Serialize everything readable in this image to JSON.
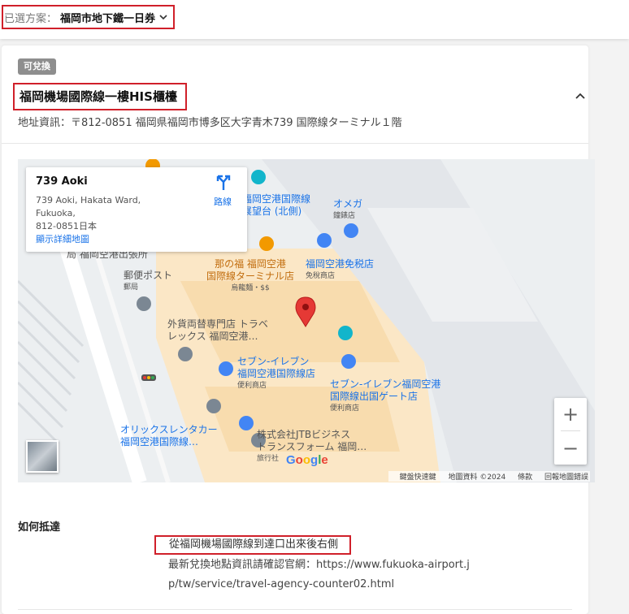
{
  "plan": {
    "prefix": "已選方案：",
    "value": "福岡市地下鐵一日券"
  },
  "location": {
    "badge": "可兌換",
    "title": "福岡機場國際線一樓HIS櫃檯",
    "address": "地址資訊：〒812-0851 福岡県福岡市博多区大字青木739 国際線ターミナル１階"
  },
  "map": {
    "place_card": {
      "title": "739 Aoki",
      "address_line1": "739 Aoki, Hakata Ward, Fukuoka,",
      "address_line2": "812-0851日本",
      "directions_label": "路線",
      "view_larger_label": "顯示詳細地圖"
    },
    "labels": {
      "airport_observation_1": "福岡空港国際線",
      "airport_observation_2": "展望台 (北側)",
      "omega_1": "オメガ",
      "omega_2": "鐘錶店",
      "duty_free_1": "福岡空港免税店",
      "duty_free_2": "免稅商店",
      "nanofuku_1": "那の福 福岡空港",
      "nanofuku_2": "国際線ターミナル店",
      "nanofuku_3": "烏龍麵・$$",
      "post_1": "郵便ポスト",
      "post_2": "郵局",
      "travelex_1": "外貨両替専門店 トラベ",
      "travelex_2": "レックス 福岡空港…",
      "seven1_1": "セブン-イレブン",
      "seven1_2": "福岡空港国際線店",
      "seven1_3": "便利商店",
      "seven2_1": "セブン-イレブン福岡空港",
      "seven2_2": "国際線出国ゲート店",
      "seven2_3": "便利商店",
      "orix_1": "オリックスレンタカー",
      "orix_2": "福岡空港国際線…",
      "jtb_1": "株式会社JTBビジネス",
      "jtb_2": "トランスフォーム 福岡…",
      "jtb_3": "旅行社",
      "branch": "福岡空港出張所",
      "branch_prefix": "局"
    },
    "zoom_in": "+",
    "zoom_out": "−",
    "google": "Google",
    "attribution": {
      "shortcuts": "鍵盤快速鍵",
      "map_data": "地圖資料 ©2024",
      "terms": "條款",
      "report": "回報地圖錯誤"
    }
  },
  "how_to_reach": {
    "title": "如何抵達",
    "step": "從福岡機場國際線到達口出來後右側",
    "note": "最新兌換地點資訊請確認官網：https://www.fukuoka-airport.jp/tw/service/travel-agency-counter02.html"
  },
  "colors": {
    "highlight_border": "#d0202a",
    "link": "#1a73e8",
    "badge_bg": "#8e8e8e",
    "map_pin": "#e53935"
  }
}
